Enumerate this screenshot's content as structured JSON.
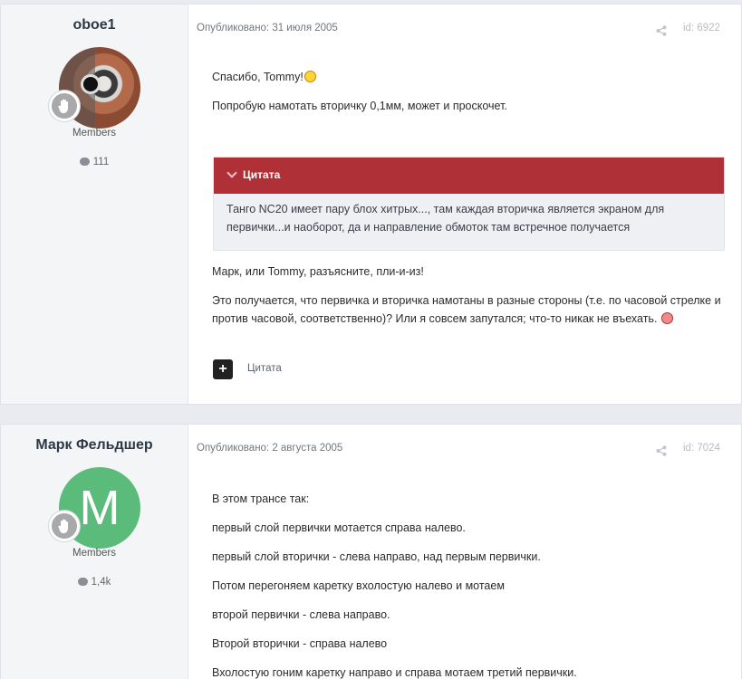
{
  "posts": [
    {
      "author": "oboe1",
      "group": "Members",
      "post_count": "111",
      "published": "Опубликовано: 31 июля 2005",
      "id_label": "id: 6922",
      "paragraphs": [
        "Спасибо, Tommy!",
        "Попробую намотать вторичку 0,1мм, может и проскочет."
      ],
      "quote": {
        "title": "Цитата",
        "text": "Танго NC20 имеет пару блох хитрых..., там каждая вторичка является экраном для первички...и наоборот, да и направление обмоток там встречное получается"
      },
      "after_quote": [
        "Марк, или Tommy, разъясните, пли-и-из!",
        "Это получается, что первичка и вторичка намотаны в разные стороны (т.е. по часовой стрелке и против часовой, соответственно)? Или я совсем запутался; что-то никак не въехать."
      ],
      "quote_button_label": "+",
      "quote_link_label": "Цитата"
    },
    {
      "author": "Марк Фельдшер",
      "avatar_letter": "M",
      "group": "Members",
      "post_count": "1,4k",
      "published": "Опубликовано: 2 августа 2005",
      "id_label": "id: 7024",
      "paragraphs": [
        "В этом трансе так:",
        "первый слой первички мотается справа налево.",
        "первый слой вторички - слева направо, над первым первички.",
        "Потом перегоняем каретку вхолостую налево и мотаем",
        "второй первички - слева направо.",
        "Второй вторички - справа налево",
        "Вхолостую гоним каретку направо и справа мотаем третий первички."
      ]
    }
  ],
  "icons": {
    "share": "share-icon",
    "comment": "comment-icon",
    "group_badge": "hand-icon",
    "chevron": "chevron-down-icon",
    "emoji_happy": "smiley-icon",
    "emoji_sad": "sad-face-icon"
  },
  "colors": {
    "quote_header": "#b03038",
    "avatar_green": "#5bbb7b",
    "author_panel": "#f3f5f7"
  }
}
